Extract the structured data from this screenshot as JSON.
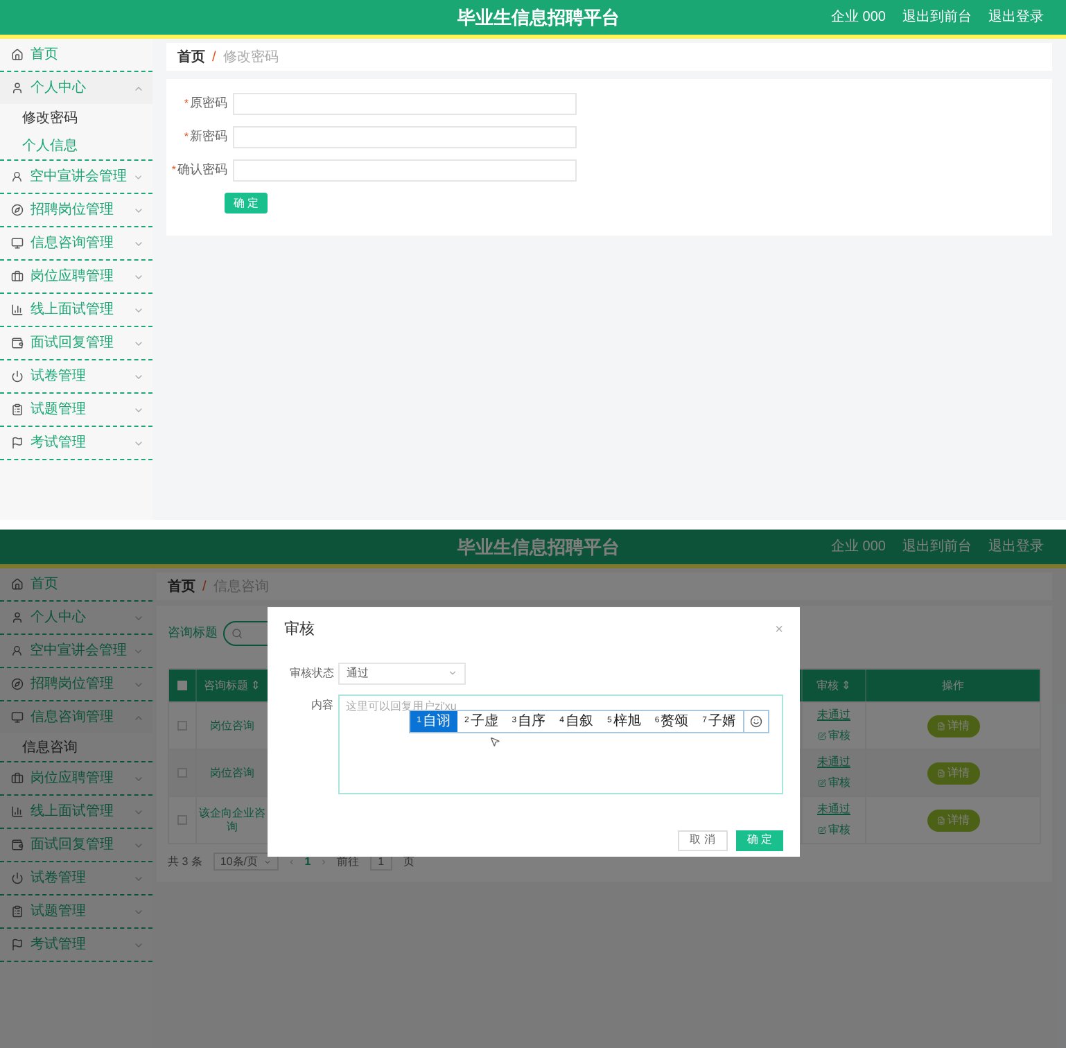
{
  "top": {
    "header": {
      "title": "毕业生信息招聘平台",
      "links": [
        "企业 000",
        "退出到前台",
        "退出登录"
      ]
    },
    "sidebar": {
      "items": [
        {
          "label": "首页",
          "kind": "link"
        },
        {
          "label": "个人中心",
          "kind": "group",
          "expanded": true,
          "children": [
            {
              "label": "修改密码",
              "selected": true
            },
            {
              "label": "个人信息",
              "selected": false
            }
          ]
        },
        {
          "label": "空中宣讲会管理",
          "kind": "group",
          "expanded": false
        },
        {
          "label": "招聘岗位管理",
          "kind": "group",
          "expanded": false
        },
        {
          "label": "信息咨询管理",
          "kind": "group",
          "expanded": false
        },
        {
          "label": "岗位应聘管理",
          "kind": "group",
          "expanded": false
        },
        {
          "label": "线上面试管理",
          "kind": "group",
          "expanded": false
        },
        {
          "label": "面试回复管理",
          "kind": "group",
          "expanded": false
        },
        {
          "label": "试卷管理",
          "kind": "group",
          "expanded": false
        },
        {
          "label": "试题管理",
          "kind": "group",
          "expanded": false
        },
        {
          "label": "考试管理",
          "kind": "group",
          "expanded": false
        }
      ]
    },
    "breadcrumb": {
      "separator": "/",
      "items": [
        "首页",
        "修改密码"
      ]
    },
    "form": {
      "fields": [
        {
          "label": "原密码",
          "mark": "*"
        },
        {
          "label": "新密码",
          "mark": "*"
        },
        {
          "label": "确认密码",
          "mark": "*"
        }
      ],
      "submit": "确 定"
    }
  },
  "bottom": {
    "header": {
      "title": "毕业生信息招聘平台",
      "links": [
        "企业 000",
        "退出到前台",
        "退出登录"
      ]
    },
    "sidebar": {
      "items": [
        {
          "label": "首页",
          "kind": "link"
        },
        {
          "label": "个人中心",
          "kind": "group",
          "expanded": false
        },
        {
          "label": "空中宣讲会管理",
          "kind": "group",
          "expanded": false
        },
        {
          "label": "招聘岗位管理",
          "kind": "group",
          "expanded": false
        },
        {
          "label": "信息咨询管理",
          "kind": "group",
          "expanded": true,
          "children": [
            {
              "label": "信息咨询",
              "selected": true
            }
          ]
        },
        {
          "label": "岗位应聘管理",
          "kind": "group",
          "expanded": false
        },
        {
          "label": "线上面试管理",
          "kind": "group",
          "expanded": false
        },
        {
          "label": "面试回复管理",
          "kind": "group",
          "expanded": false
        },
        {
          "label": "试卷管理",
          "kind": "group",
          "expanded": false
        },
        {
          "label": "试题管理",
          "kind": "group",
          "expanded": false
        },
        {
          "label": "考试管理",
          "kind": "group",
          "expanded": false
        }
      ]
    },
    "breadcrumb": {
      "separator": "/",
      "items": [
        "首页",
        "信息咨询"
      ]
    },
    "search": {
      "label": "咨询标题"
    },
    "table": {
      "select_all_checked": false,
      "columns": [
        "咨询标题 ⇕",
        "审核 ⇕",
        "操作"
      ],
      "rows": [
        {
          "checked": false,
          "title": "岗位咨询",
          "status": "未通过",
          "review": "审核",
          "action": "详情"
        },
        {
          "checked": false,
          "title": "岗位咨询",
          "status": "未通过",
          "review": "审核",
          "action": "详情"
        },
        {
          "checked": false,
          "title": "该企向企业咨询",
          "status": "未通过",
          "review": "审核",
          "action": "详情"
        }
      ]
    },
    "pagination": {
      "total": "共 3 条",
      "page_size": "10条/页",
      "prev": "‹",
      "pages": [
        {
          "label": "1",
          "selected": true
        }
      ],
      "next": "›",
      "goto_label": "前往",
      "goto_value": "1",
      "goto_suffix": "页"
    },
    "dialog": {
      "title": "审核",
      "close": "×",
      "status_label": "审核状态",
      "status_value": "通过",
      "content_label": "内容",
      "content_placeholder": "这里可以回复用户",
      "composition": "zi'xu",
      "candidates": [
        {
          "label": "自诩",
          "index": "1",
          "selected": true
        },
        {
          "label": "子虚",
          "index": "2",
          "selected": false
        },
        {
          "label": "自序",
          "index": "3",
          "selected": false
        },
        {
          "label": "自叙",
          "index": "4",
          "selected": false
        },
        {
          "label": "梓旭",
          "index": "5",
          "selected": false
        },
        {
          "label": "赘颂",
          "index": "6",
          "selected": false
        },
        {
          "label": "子婿",
          "index": "7",
          "selected": false
        }
      ],
      "cancel": "取 消",
      "confirm": "确 定"
    }
  }
}
